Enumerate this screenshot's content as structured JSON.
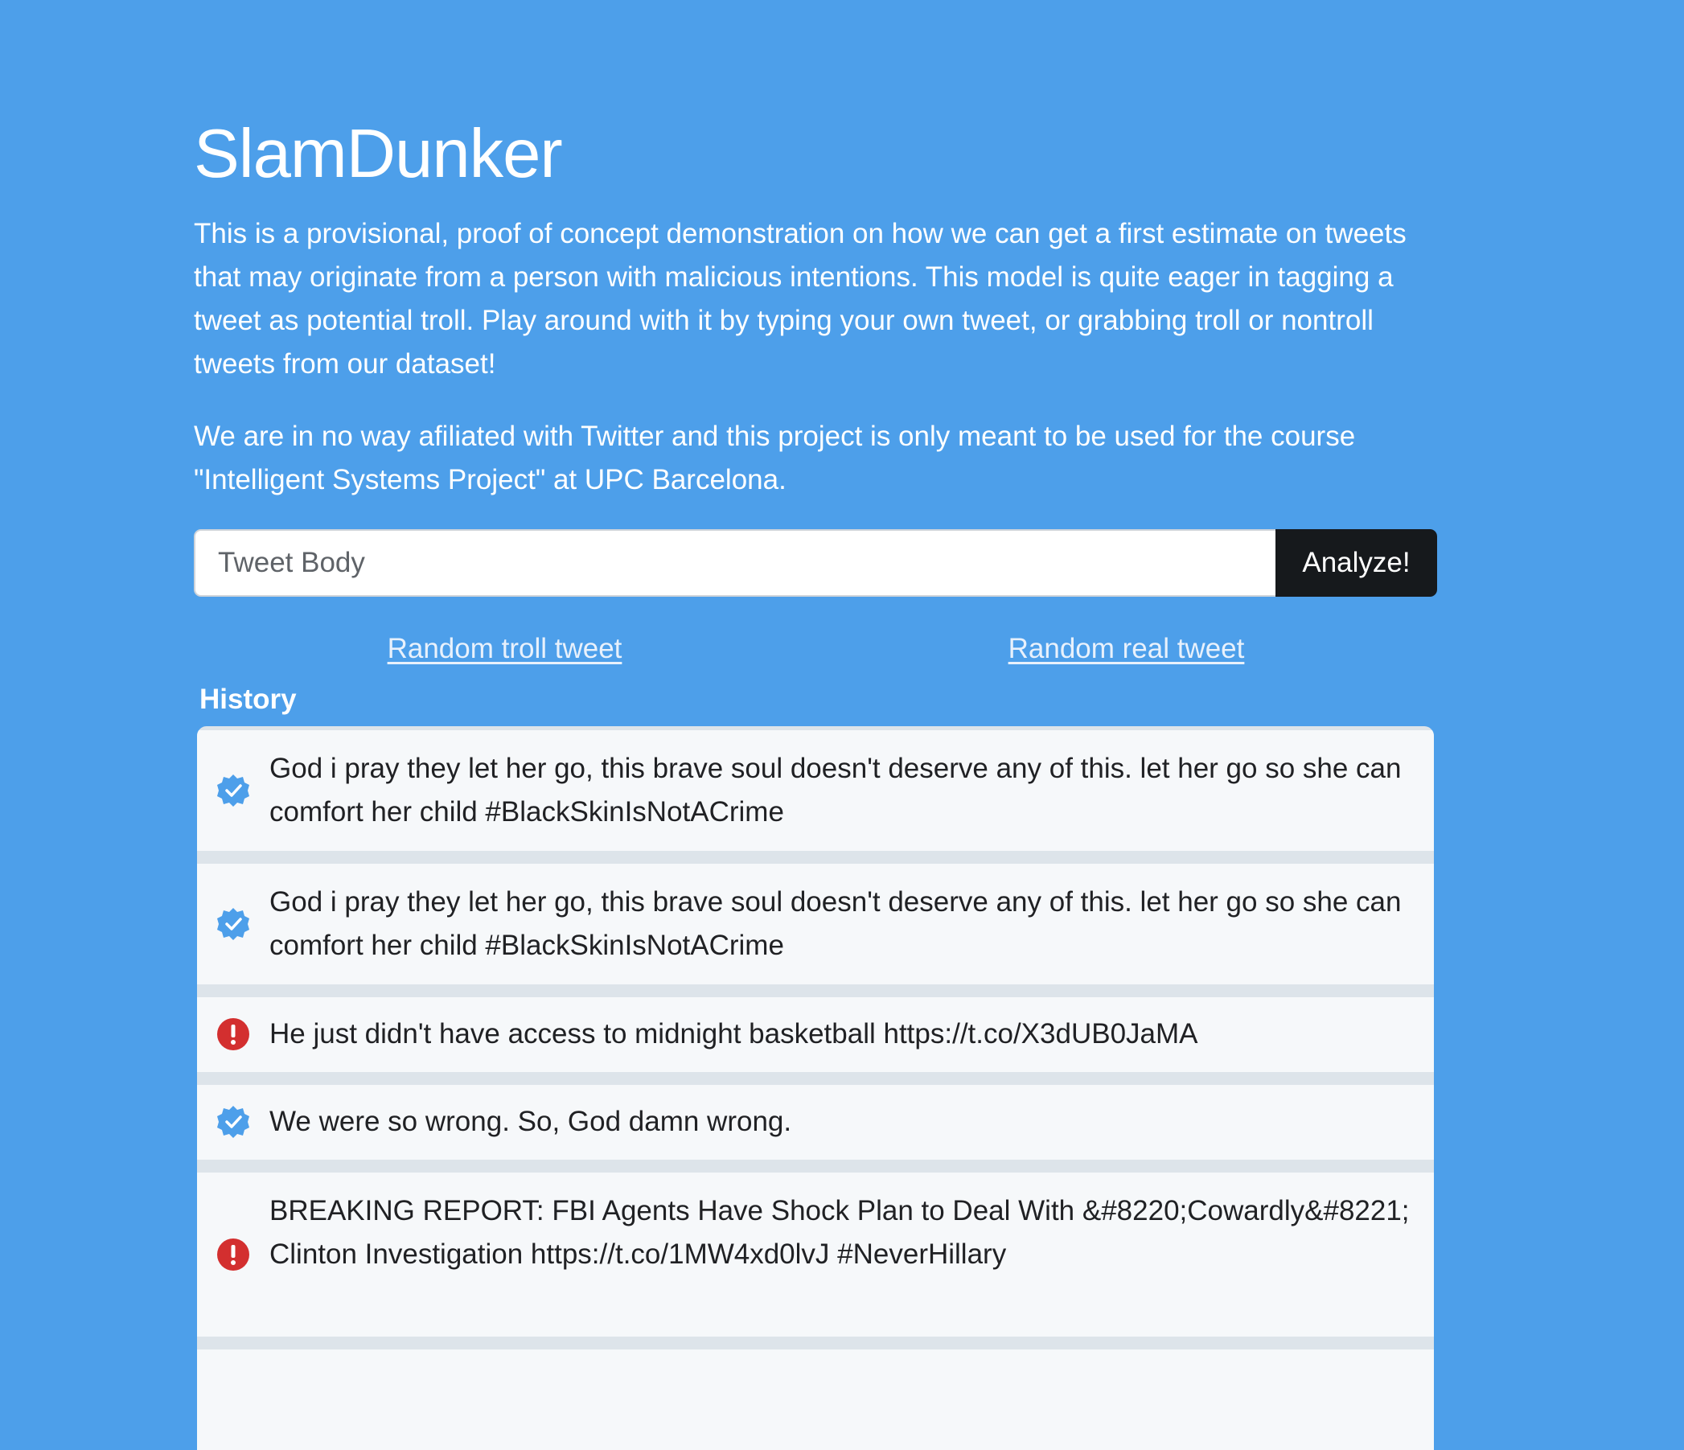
{
  "app": {
    "title": "SlamDunker",
    "intro": "This is a provisional, proof of concept demonstration on how we can get a first estimate on tweets that may originate from a person with malicious intentions. This model is quite eager in tagging a tweet as potential troll. Play around with it by typing your own tweet, or grabbing troll or nontroll tweets from our dataset!",
    "disclaimer": "We are in no way afiliated with Twitter and this project is only meant to be used for the course \"Intelligent Systems Project\" at UPC Barcelona."
  },
  "search": {
    "placeholder": "Tweet Body",
    "value": "",
    "button_label": "Analyze!"
  },
  "links": {
    "troll_label": "Random troll tweet",
    "real_label": "Random real tweet"
  },
  "history": {
    "heading": "History",
    "items": [
      {
        "status": "real",
        "icon": "verified-check-icon",
        "text": "God i pray they let her go, this brave soul doesn't deserve any of this. let her go so she can comfort her child #BlackSkinIsNotACrime"
      },
      {
        "status": "real",
        "icon": "verified-check-icon",
        "text": "God i pray they let her go, this brave soul doesn't deserve any of this. let her go so she can comfort her child #BlackSkinIsNotACrime"
      },
      {
        "status": "troll",
        "icon": "alert-icon",
        "text": "He just didn't have access to midnight basketball https://t.co/X3dUB0JaMA"
      },
      {
        "status": "real",
        "icon": "verified-check-icon",
        "text": "We were so wrong. So, God damn wrong."
      },
      {
        "status": "troll",
        "icon": "alert-icon",
        "text": "BREAKING REPORT: FBI Agents Have Shock Plan to Deal With &#8220;Cowardly&#8221; Clinton Investigation https://t.co/1MW4xd0lvJ #NeverHillary"
      }
    ]
  },
  "colors": {
    "background": "#4d9fea",
    "button": "#16191c",
    "real_icon": "#4d9fea",
    "troll_icon": "#d32f2f",
    "list_item": "#f6f8fa",
    "list_separator": "#dde4ea"
  }
}
